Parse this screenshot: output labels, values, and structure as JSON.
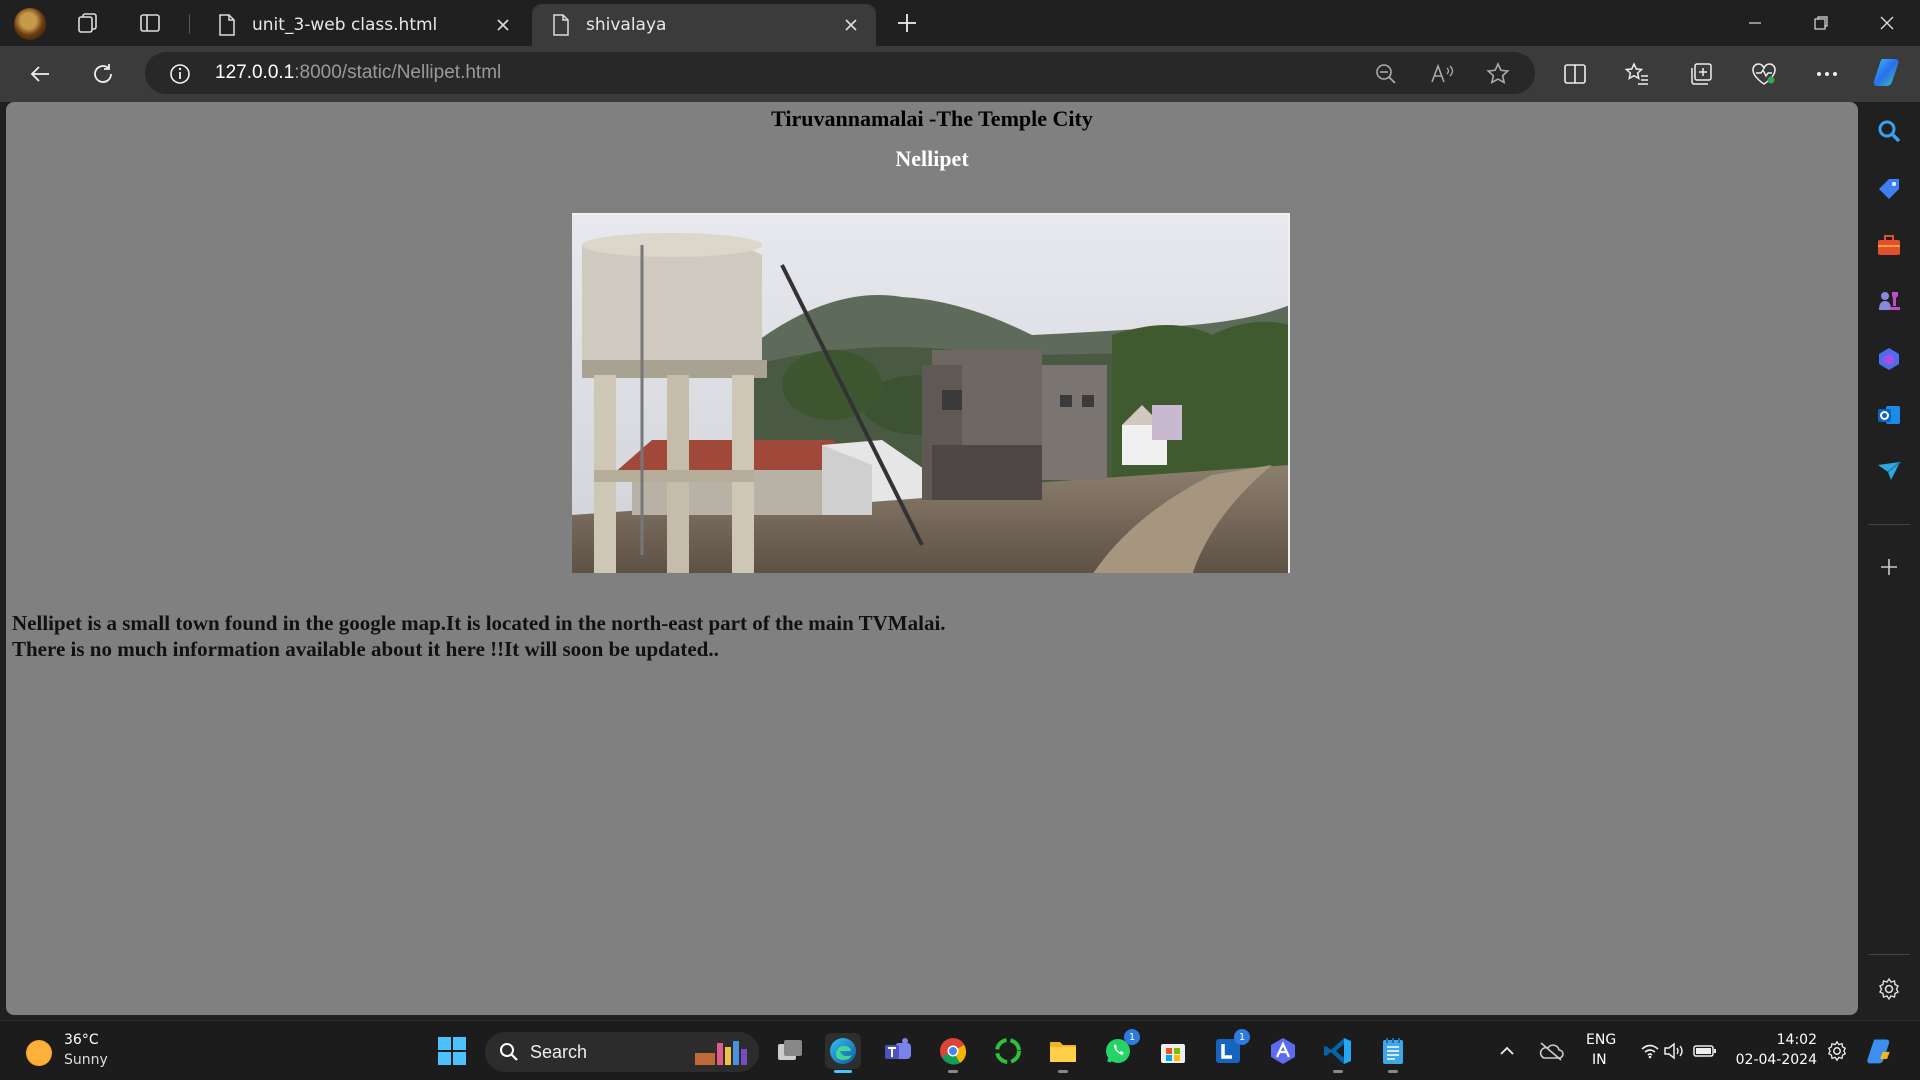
{
  "browser": {
    "tabs": [
      {
        "title": "unit_3-web class.html"
      },
      {
        "title": "shivalaya"
      }
    ],
    "address": {
      "host": "127.0.0.1",
      "rest": ":8000/static/Nellipet.html"
    }
  },
  "page": {
    "heading": "Tiruvannamalai -The Temple City",
    "subheading": "Nellipet",
    "paragraph_line1": "Nellipet is a small town found in the google map.It is located in the north-east part of the main TVMalai.",
    "paragraph_line2": "There is no much information available about it here !!It will soon be updated.."
  },
  "taskbar": {
    "weather": {
      "temp": "36°C",
      "condition": "Sunny"
    },
    "search_placeholder": "Search",
    "badges": {
      "whatsapp": "1",
      "ms_word_l": "1"
    },
    "tray": {
      "lang_1": "ENG",
      "lang_2": "IN",
      "time": "14:02",
      "date": "02-04-2024"
    }
  },
  "colors": {
    "page_bg": "#808080",
    "chrome_bg": "#202020",
    "toolbar_bg": "#3b3b3b",
    "accent": "#4cc2ff"
  }
}
